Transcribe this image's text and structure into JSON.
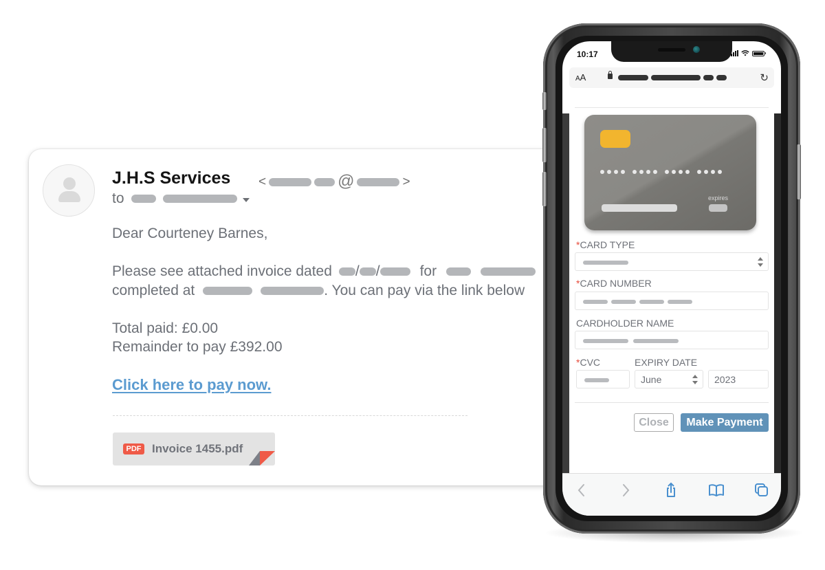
{
  "email": {
    "sender_name": "J.H.S Services",
    "sender_address_open": "<",
    "sender_address_at": "@",
    "sender_address_close": ">",
    "to_label": "to",
    "greeting": "Dear Courteney Barnes,",
    "body_line1_prefix": "Please see attached invoice dated",
    "date_sep": "/",
    "body_line1_for": "for",
    "body_line2_prefix": "completed at",
    "body_line2_suffix": ". You can pay via the link below",
    "total_paid": "Total paid: £0.00",
    "remainder": "Remainder to pay £392.00",
    "pay_link": "Click here to pay now.",
    "attachment": {
      "badge": "PDF",
      "filename": "Invoice 1455.pdf"
    }
  },
  "phone": {
    "status_time": "10:17",
    "url_bar": {
      "text_size_label_small": "A",
      "text_size_label_large": "A"
    },
    "card_preview": {
      "expires_label": "expires"
    },
    "form": {
      "required_marker": "*",
      "card_type_label": "CARD TYPE",
      "card_number_label": "CARD NUMBER",
      "cardholder_label": "CARDHOLDER NAME",
      "cvc_label": "CVC",
      "expiry_label": "EXPIRY DATE",
      "expiry_month": "June",
      "expiry_year": "2023",
      "close_button": "Close",
      "pay_button": "Make Payment"
    },
    "toolbar": {
      "icons": [
        "back-icon",
        "forward-icon",
        "share-icon",
        "bookmarks-icon",
        "tabs-icon"
      ]
    }
  },
  "colors": {
    "link": "#5b9bd0",
    "primary_button": "#6092b8",
    "pdf_badge": "#ef5a47",
    "card_chip": "#f2b52e",
    "required": "#e74c3c",
    "toolbar_icon_active": "#4a90cf"
  }
}
